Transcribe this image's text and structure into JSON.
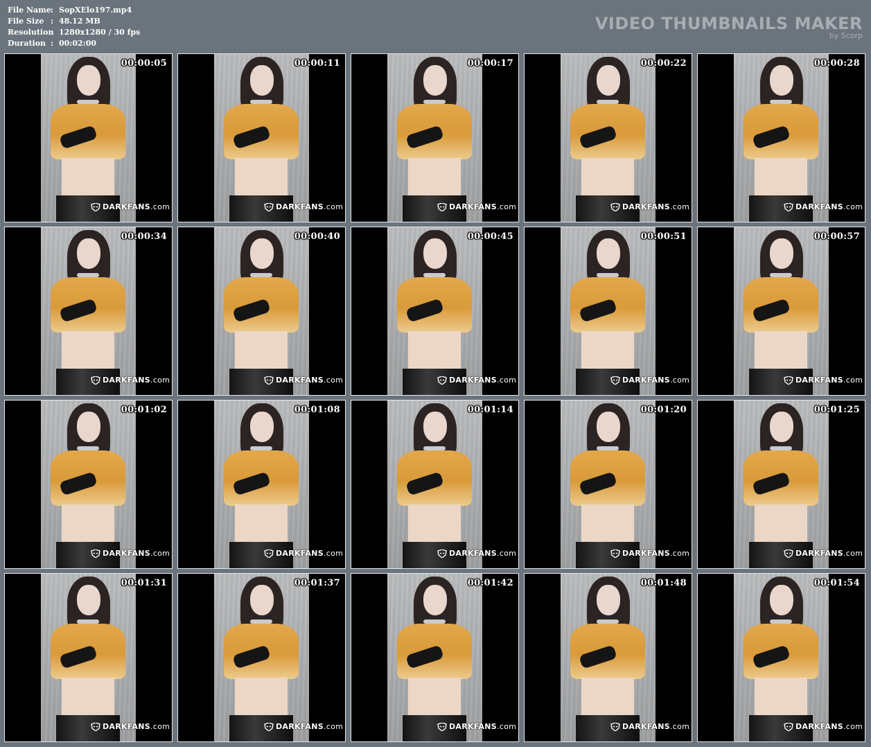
{
  "info": [
    {
      "key": "File Name",
      "value": "SopXElo197.mp4"
    },
    {
      "key": "File Size",
      "value": "48.12 MB"
    },
    {
      "key": "Resolution",
      "value": "1280x1280 / 30 fps"
    },
    {
      "key": "Duration",
      "value": "00:02:00"
    }
  ],
  "brand": {
    "title": "VIDEO THUMBNAILS MAKER",
    "subtitle": "by Scorp"
  },
  "watermark": {
    "strong": "DARKFANS",
    "suffix": ".com",
    "icon": "darkfans-mask-icon"
  },
  "thumbnails": [
    {
      "time": "00:00:05"
    },
    {
      "time": "00:00:11"
    },
    {
      "time": "00:00:17"
    },
    {
      "time": "00:00:22"
    },
    {
      "time": "00:00:28"
    },
    {
      "time": "00:00:34"
    },
    {
      "time": "00:00:40"
    },
    {
      "time": "00:00:45"
    },
    {
      "time": "00:00:51"
    },
    {
      "time": "00:00:57"
    },
    {
      "time": "00:01:02"
    },
    {
      "time": "00:01:08"
    },
    {
      "time": "00:01:14"
    },
    {
      "time": "00:01:20"
    },
    {
      "time": "00:01:25"
    },
    {
      "time": "00:01:31"
    },
    {
      "time": "00:01:37"
    },
    {
      "time": "00:01:42"
    },
    {
      "time": "00:01:48"
    },
    {
      "time": "00:01:54"
    }
  ],
  "colors": {
    "background": "#6b747c",
    "brand_text": "#a8adb2",
    "thumb_border": "#e8eaec"
  }
}
